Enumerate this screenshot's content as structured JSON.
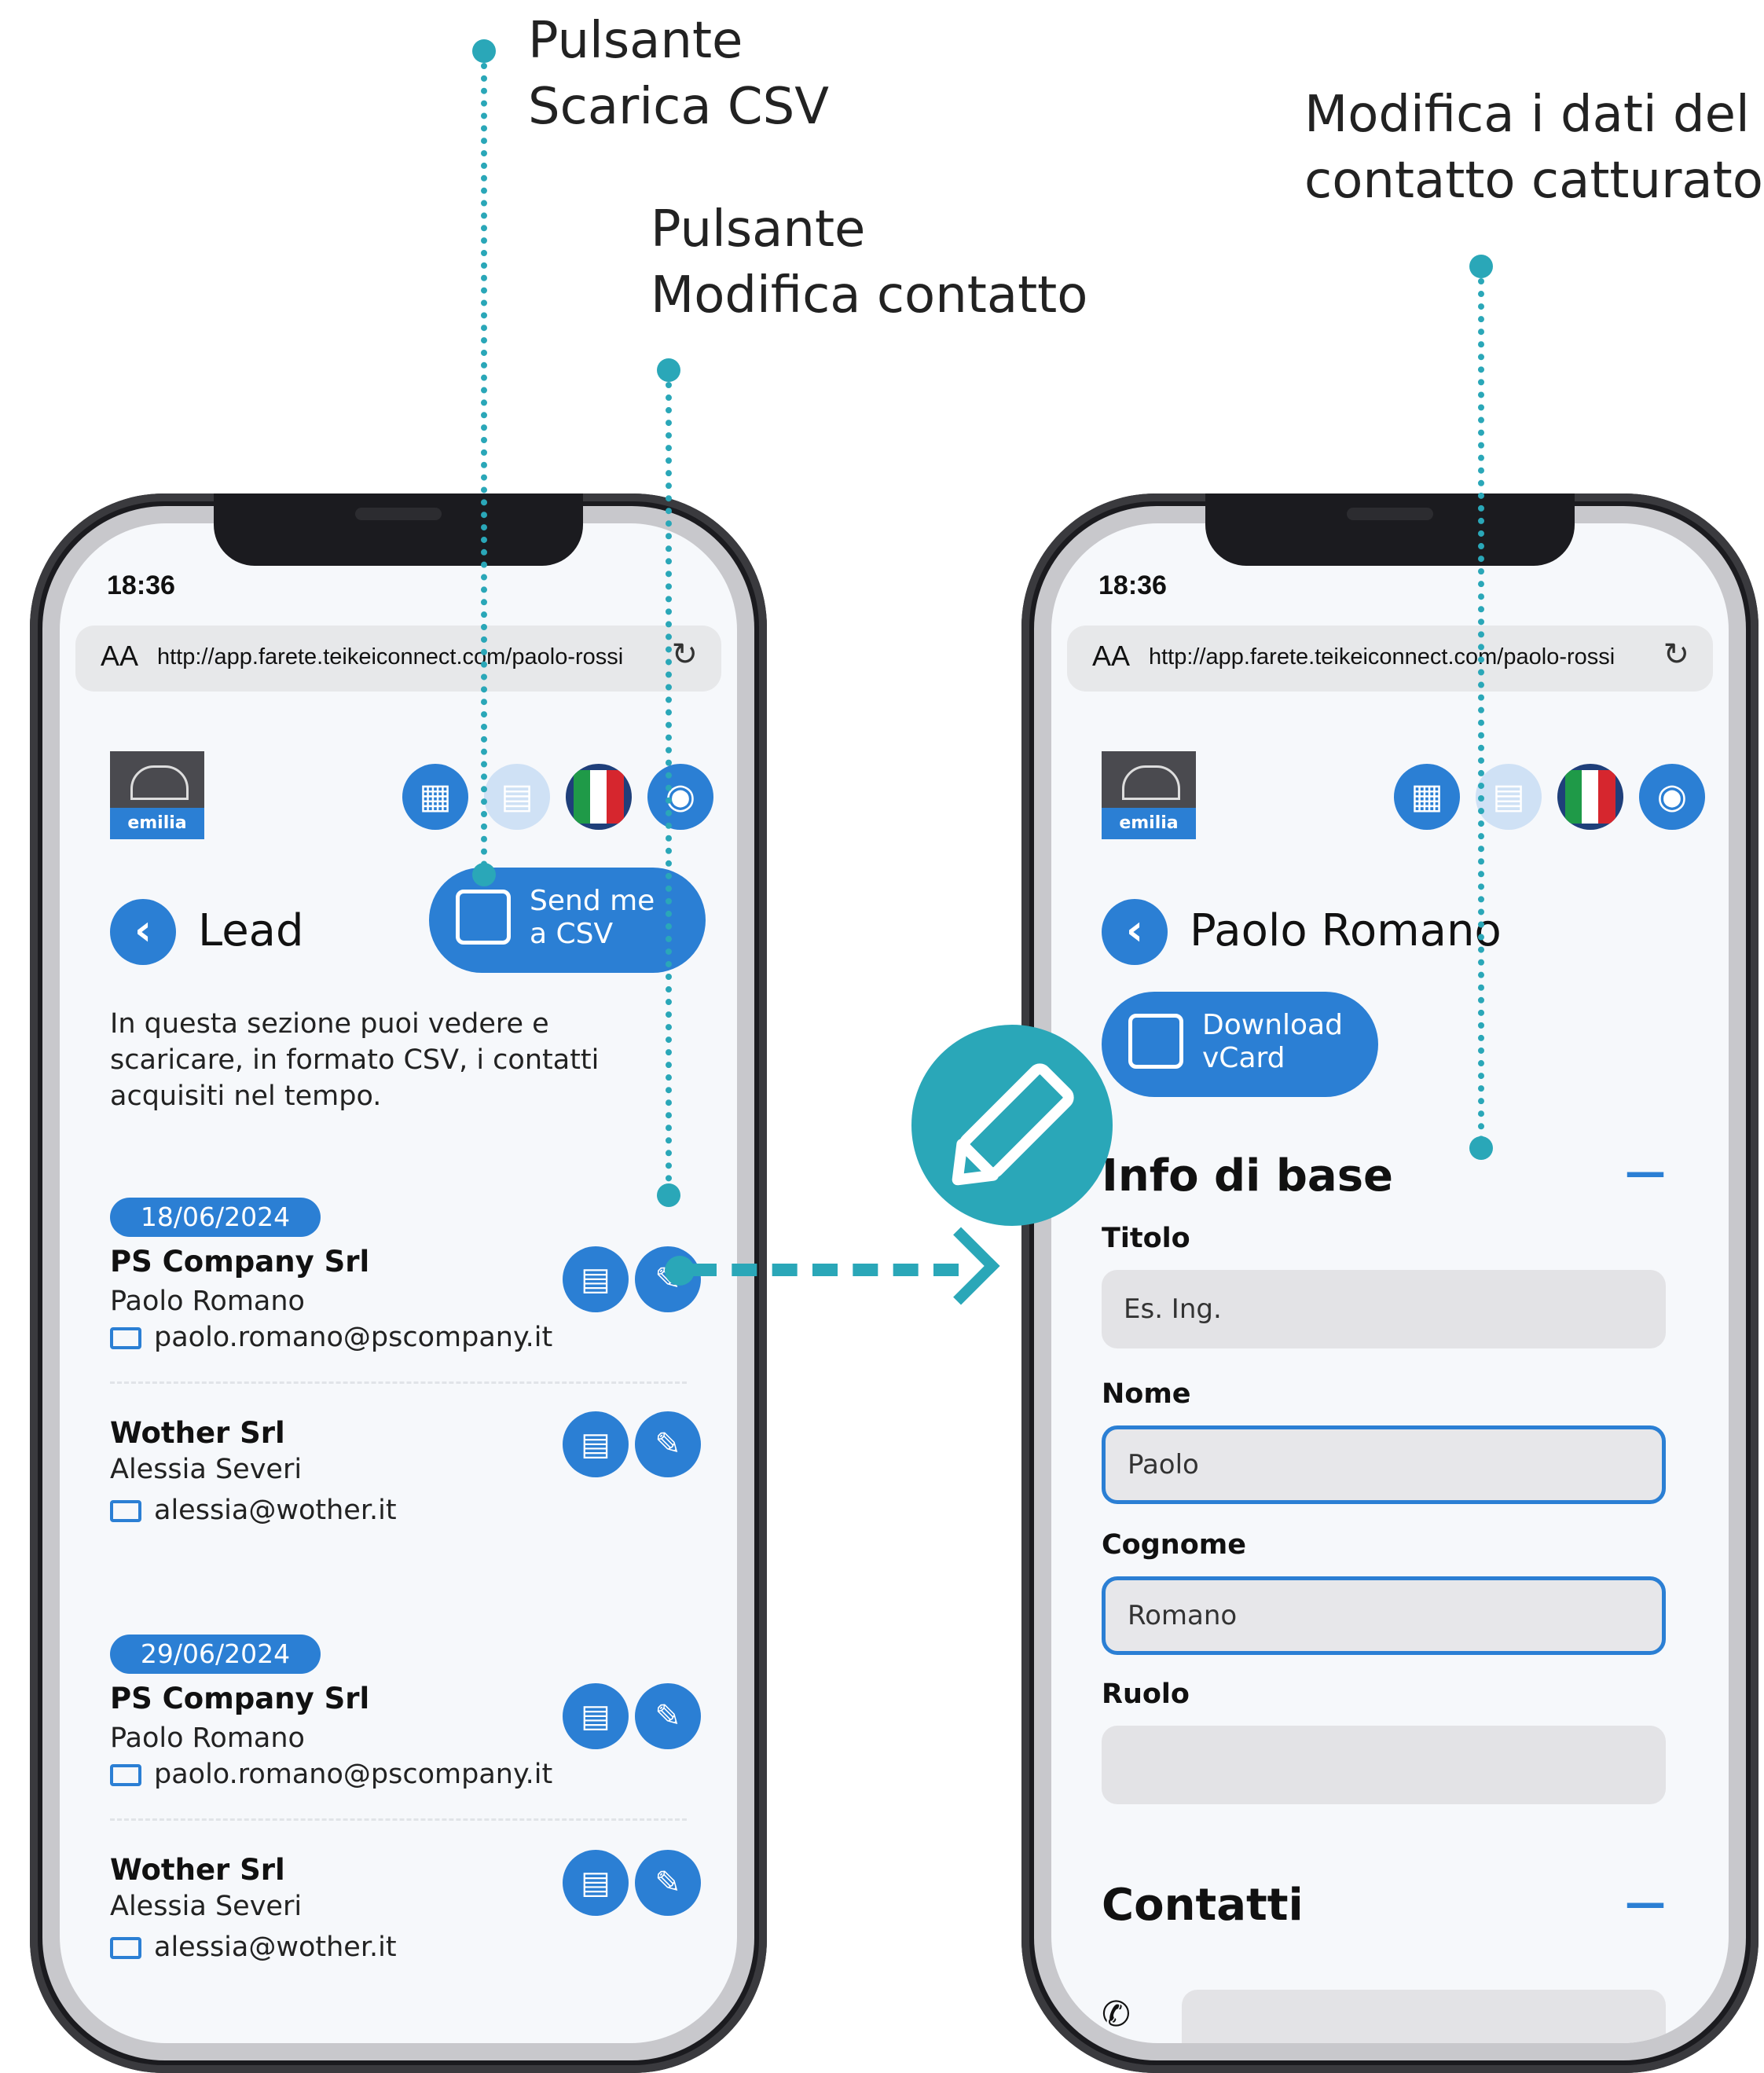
{
  "annotations": {
    "csv_button": [
      "Pulsante",
      "Scarica CSV"
    ],
    "edit_button": [
      "Pulsante",
      "Modifica contatto"
    ],
    "edit_data": [
      "Modifica i dati del",
      "contatto catturato"
    ]
  },
  "colors": {
    "accent": "#2aa7b8",
    "brand": "#2b7fd4"
  },
  "status_bar": {
    "time": "18:36"
  },
  "browser": {
    "aa": "AA",
    "url": "http://app.farete.teikeiconnect.com/paolo-rossi",
    "reload_icon": "reload-icon"
  },
  "logo": {
    "text": "emilia"
  },
  "toolbar_icons": [
    "qr-code-icon",
    "contact-card-icon",
    "italian-flag-icon",
    "eye-icon"
  ],
  "lead_screen": {
    "title": "Lead",
    "csv_button": [
      "Send me",
      "a CSV"
    ],
    "description": "In questa sezione puoi vedere e scaricare, in formato CSV, i contatti acquisiti nel tempo.",
    "groups": [
      {
        "date": "18/06/2024",
        "contacts": [
          {
            "company": "PS Company Srl",
            "name": "Paolo Romano",
            "email": "paolo.romano@pscompany.it"
          },
          {
            "company": "Wother Srl",
            "name": "Alessia Severi",
            "email": "alessia@wother.it"
          }
        ]
      },
      {
        "date": "29/06/2024",
        "contacts": [
          {
            "company": "PS Company Srl",
            "name": "Paolo Romano",
            "email": "paolo.romano@pscompany.it"
          },
          {
            "company": "Wother Srl",
            "name": "Alessia Severi",
            "email": "alessia@wother.it"
          }
        ]
      }
    ]
  },
  "detail_screen": {
    "title": "Paolo Romano",
    "vcard_button": [
      "Download",
      "vCard"
    ],
    "section_basic": "Info di base",
    "collapse_symbol": "—",
    "fields": [
      {
        "label": "Titolo",
        "value": "",
        "placeholder": "Es. Ing."
      },
      {
        "label": "Nome",
        "value": "Paolo",
        "placeholder": ""
      },
      {
        "label": "Cognome",
        "value": "Romano",
        "placeholder": ""
      },
      {
        "label": "Ruolo",
        "value": "",
        "placeholder": ""
      }
    ],
    "section_contacts": "Contatti"
  }
}
